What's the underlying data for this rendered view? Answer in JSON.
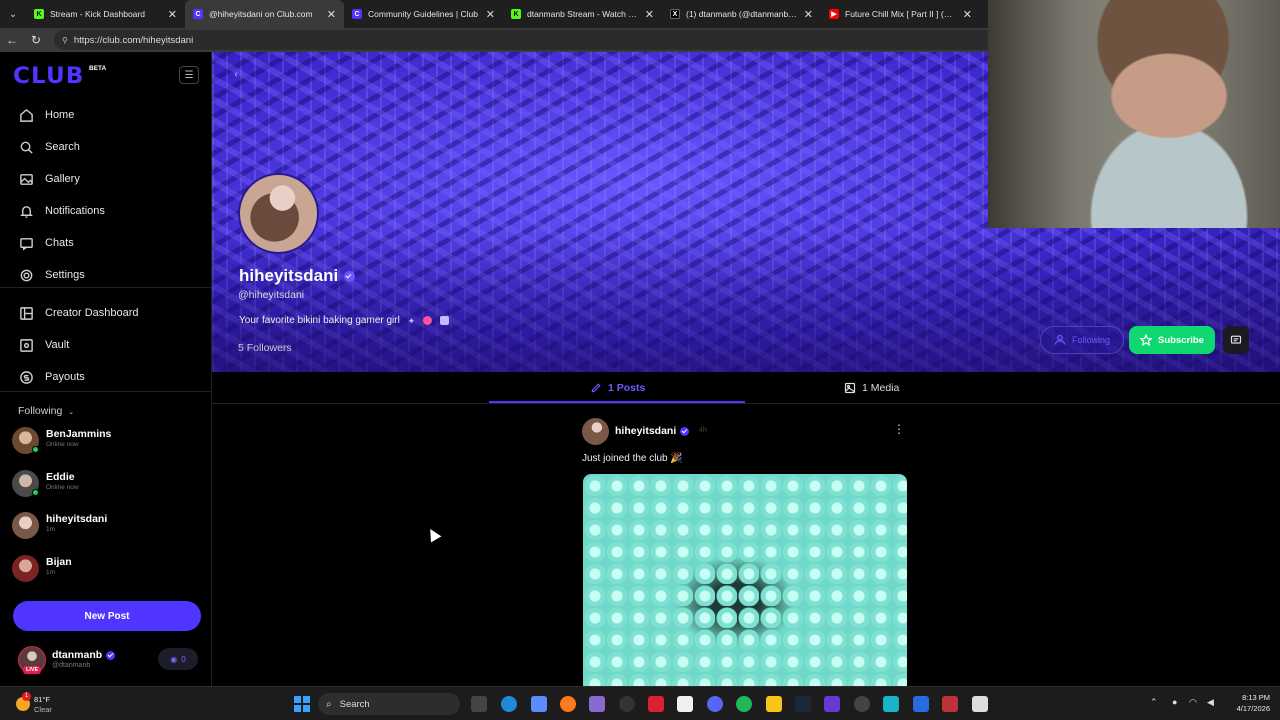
{
  "browser": {
    "tabs": [
      {
        "title": "Stream - Kick Dashboard",
        "icon": "kick-icon",
        "color": "#53fc18",
        "active": false
      },
      {
        "title": "@hiheyitsdani on Club.com",
        "icon": "club-icon",
        "color": "#4f35ff",
        "active": true
      },
      {
        "title": "Community Guidelines | Club",
        "icon": "club-icon",
        "color": "#4f35ff",
        "active": false
      },
      {
        "title": "dtanmanb Stream - Watch Live on",
        "icon": "kick-icon",
        "color": "#53fc18",
        "active": false
      },
      {
        "title": "(1) dtanmanb (@dtanmanb) / X",
        "icon": "x-icon",
        "color": "#000000",
        "active": false
      },
      {
        "title": "Future Chill Mix [ Part II ] (1 H",
        "icon": "youtube-icon",
        "color": "#ff0000",
        "active": false
      }
    ],
    "url": "https://club.com/hiheyitsdani"
  },
  "sidebar": {
    "logo": "CLUB",
    "beta": "BETA",
    "nav": [
      {
        "label": "Home",
        "icon": "home-icon"
      },
      {
        "label": "Search",
        "icon": "search-icon"
      },
      {
        "label": "Gallery",
        "icon": "gallery-icon"
      },
      {
        "label": "Notifications",
        "icon": "bell-icon"
      },
      {
        "label": "Chats",
        "icon": "chat-icon"
      },
      {
        "label": "Settings",
        "icon": "gear-icon"
      }
    ],
    "creator_nav": [
      {
        "label": "Creator Dashboard",
        "icon": "dashboard-icon"
      },
      {
        "label": "Vault",
        "icon": "vault-icon"
      },
      {
        "label": "Payouts",
        "icon": "payouts-icon"
      }
    ],
    "following_label": "Following",
    "following": [
      {
        "name": "BenJammins",
        "status": "Online now",
        "online": true,
        "color": "#8a6a4a"
      },
      {
        "name": "Eddie",
        "status": "Online now",
        "online": true,
        "color": "#6a6a6a"
      },
      {
        "name": "hiheyitsdani",
        "status": "1m",
        "online": false,
        "color": "#9a7060"
      },
      {
        "name": "Bijan",
        "status": "1m",
        "online": false,
        "color": "#8a3030"
      }
    ],
    "new_post": "New Post",
    "me": {
      "name": "dtanmanb",
      "handle": "@dtanmanb",
      "live": "LIVE",
      "tokens": "0"
    }
  },
  "profile": {
    "name": "hiheyitsdani",
    "handle": "@hiheyitsdani",
    "bio": "Your favorite bikini baking gamer girl",
    "followers": "5 Followers",
    "following_btn": "Following",
    "subscribe_btn": "Subscribe",
    "tabs": [
      {
        "label": "1 Posts",
        "icon": "pencil-icon",
        "active": true
      },
      {
        "label": "1 Media",
        "icon": "image-icon",
        "active": false
      }
    ]
  },
  "post": {
    "author": "hiheyitsdani",
    "time": "4h",
    "text": "Just joined the club 🎉"
  },
  "taskbar": {
    "temp": "81°F",
    "condition": "Clear",
    "search": "Search",
    "time": "8:13 PM",
    "date": "4/17/2026"
  },
  "colors": {
    "brand": "#4f35ff",
    "subscribe": "#10d870",
    "online": "#1fcf6a"
  }
}
